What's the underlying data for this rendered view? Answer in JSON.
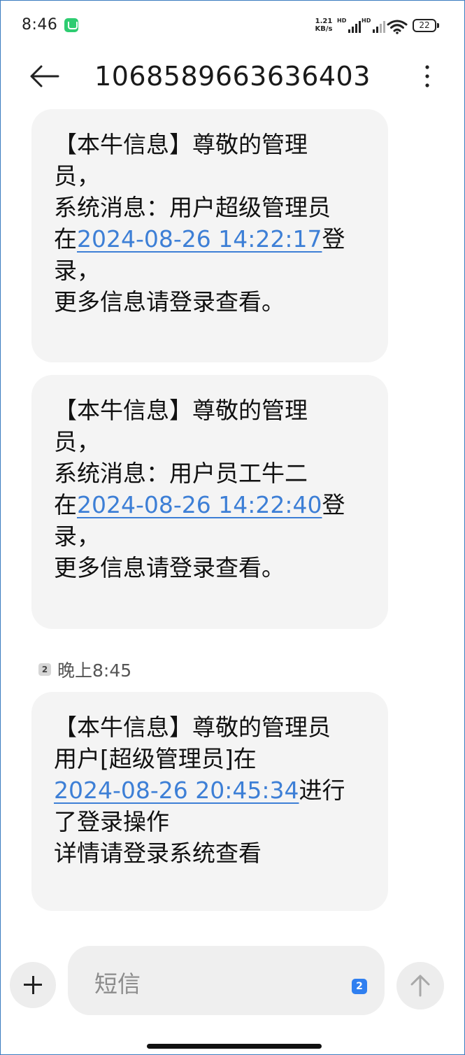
{
  "status_bar": {
    "time": "8:46",
    "network_speed_value": "1.21",
    "network_speed_unit": "KB/s",
    "sim1_label": "HD",
    "sim2_label": "HD",
    "battery": "22",
    "icons": [
      "app-notification-icon",
      "signal-icon",
      "wifi-icon",
      "battery-icon"
    ]
  },
  "header": {
    "title": "1068589663636403",
    "icons": [
      "back-arrow-icon",
      "more-vertical-icon"
    ]
  },
  "messages": [
    {
      "lines": [
        "【本牛信息】尊敬的管理",
        "员，",
        "系统消息：用户超级管理员"
      ],
      "ts_prefix": "在",
      "timestamp": "2024-08-26 14:22:17",
      "ts_suffix": "登",
      "tail_lines": [
        "录，",
        "更多信息请登录查看。"
      ]
    },
    {
      "lines": [
        "【本牛信息】尊敬的管理",
        "员，",
        "系统消息：用户员工牛二"
      ],
      "ts_prefix": "在",
      "timestamp": "2024-08-26 14:22:40",
      "ts_suffix": "登",
      "tail_lines": [
        "录，",
        "更多信息请登录查看。"
      ]
    },
    {
      "lines": [
        "【本牛信息】尊敬的管理员",
        "用户[超级管理员]在"
      ],
      "ts_prefix": "",
      "timestamp": "2024-08-26 20:45:34",
      "ts_suffix": "进行",
      "tail_lines": [
        "了登录操作",
        "详情请登录系统查看"
      ]
    }
  ],
  "meta": {
    "sim_badge": "2",
    "time_label": "晚上8:45"
  },
  "compose": {
    "placeholder": "短信",
    "sim_badge": "2",
    "icons": [
      "plus-icon",
      "send-arrow-icon"
    ]
  },
  "colors": {
    "link": "#3d7fd6",
    "bubble": "#f4f4f4",
    "compose_sim": "#2f7ff0"
  }
}
